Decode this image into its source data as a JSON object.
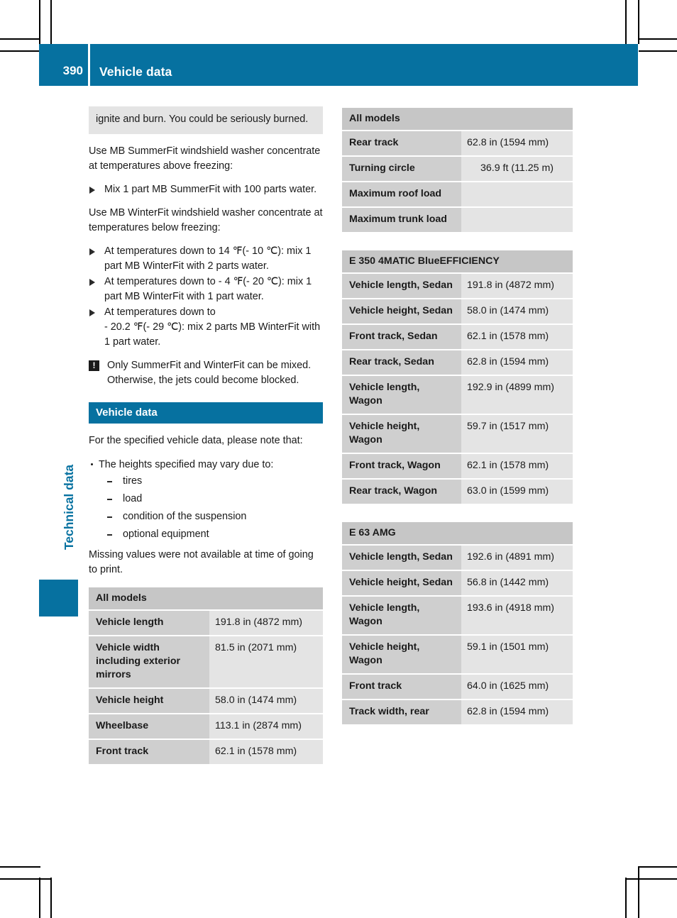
{
  "header": {
    "page_number": "390",
    "title": "Vehicle data",
    "accent_color": "#0671a0"
  },
  "chapter_tab": {
    "label": "Technical data"
  },
  "left_column": {
    "warning_continuation": "ignite and burn. You could be seriously burned.",
    "summerfit_intro": "Use MB SummerFit windshield washer concentrate at temperatures above freezing:",
    "summerfit_steps": [
      "Mix 1 part MB SummerFit with 100 parts water."
    ],
    "winterfit_intro": "Use MB WinterFit windshield washer concentrate at temperatures below freezing:",
    "winterfit_steps": [
      "At temperatures down to 14 ℉(- 10 ℃): mix 1 part MB WinterFit with 2 parts water.",
      "At temperatures down to - 4 ℉(- 20 ℃): mix 1 part MB WinterFit with 1 part water.",
      "At temperatures down to\n- 20.2 ℉(- 29 ℃): mix 2 parts MB WinterFit with 1 part water."
    ],
    "note": {
      "icon": "warning-exclamation-icon",
      "icon_glyph": "!",
      "text": "Only SummerFit and WinterFit can be mixed. Otherwise, the jets could become blocked."
    },
    "section_heading": "Vehicle data",
    "intro": "For the specified vehicle data, please note that:",
    "bullet": "The heights specified may vary due to:",
    "sub_items": [
      "tires",
      "load",
      "condition of the suspension",
      "optional equipment"
    ],
    "footnote": "Missing values were not available at time of going to print."
  },
  "tables": [
    {
      "id": "all-models-left",
      "caption": "All models",
      "rows": [
        {
          "label": "Vehicle length",
          "value": "191.8 in (4872 mm)"
        },
        {
          "label": "Vehicle width including exterior mirrors",
          "value": "81.5 in (2071 mm)"
        },
        {
          "label": "Vehicle height",
          "value": "58.0 in (1474 mm)"
        },
        {
          "label": "Wheelbase",
          "value": "113.1 in (2874 mm)"
        },
        {
          "label": "Front track",
          "value": "62.1 in (1578 mm)"
        }
      ]
    },
    {
      "id": "all-models-right",
      "caption": "All models",
      "rows": [
        {
          "label": "Rear track",
          "value": "62.8 in (1594 mm)"
        },
        {
          "label": "Turning circle",
          "value": "36.9 ft (11.25 m)"
        },
        {
          "label": "Maximum roof load",
          "value": ""
        },
        {
          "label": "Maximum trunk load",
          "value": ""
        }
      ]
    },
    {
      "id": "e350-4matic-blueefficiency",
      "caption": "E 350 4MATIC BlueEFFICIENCY",
      "rows": [
        {
          "label": "Vehicle length, Sedan",
          "value": "191.8 in (4872 mm)"
        },
        {
          "label": "Vehicle height, Sedan",
          "value": "58.0 in (1474 mm)"
        },
        {
          "label": "Front track, Sedan",
          "value": "62.1 in (1578 mm)"
        },
        {
          "label": "Rear track, Sedan",
          "value": "62.8 in (1594 mm)"
        },
        {
          "label": "Vehicle length, Wagon",
          "value": "192.9 in (4899 mm)"
        },
        {
          "label": "Vehicle height, Wagon",
          "value": "59.7 in (1517 mm)"
        },
        {
          "label": "Front track, Wagon",
          "value": "62.1 in (1578 mm)"
        },
        {
          "label": "Rear track, Wagon",
          "value": "63.0 in (1599 mm)"
        }
      ]
    },
    {
      "id": "e63-amg",
      "caption": "E 63 AMG",
      "rows": [
        {
          "label": "Vehicle length, Sedan",
          "value": "192.6 in (4891 mm)"
        },
        {
          "label": "Vehicle height, Sedan",
          "value": "56.8 in (1442 mm)"
        },
        {
          "label": "Vehicle length, Wagon",
          "value": "193.6 in (4918 mm)"
        },
        {
          "label": "Vehicle height, Wagon",
          "value": "59.1 in (1501 mm)"
        },
        {
          "label": "Front track",
          "value": "64.0 in (1625 mm)"
        },
        {
          "label": "Track width, rear",
          "value": "62.8 in (1594 mm)"
        }
      ]
    }
  ]
}
